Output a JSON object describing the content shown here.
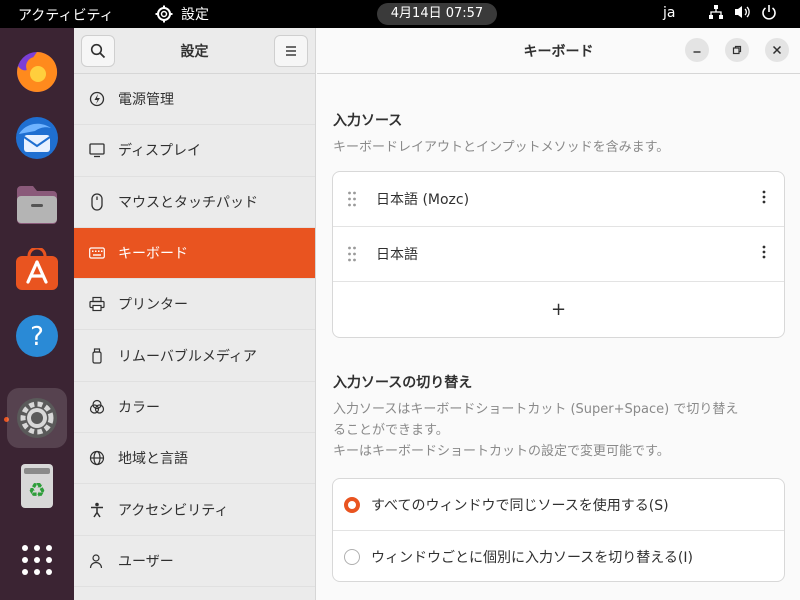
{
  "topbar": {
    "activities": "アクティビティ",
    "app_menu": "設定",
    "clock": "4月14日  07:57",
    "lang": "ja"
  },
  "dock": {
    "items": [
      "firefox-icon",
      "thunderbird-icon",
      "files-icon",
      "app-center-icon",
      "help-icon",
      "settings-icon",
      "trash-icon",
      "app-grid-icon"
    ]
  },
  "sidebar": {
    "title": "設定",
    "items": [
      {
        "label": "電源管理",
        "icon": "power-icon"
      },
      {
        "label": "ディスプレイ",
        "icon": "display-icon"
      },
      {
        "label": "マウスとタッチパッド",
        "icon": "mouse-icon"
      },
      {
        "label": "キーボード",
        "icon": "keyboard-icon",
        "selected": true
      },
      {
        "label": "プリンター",
        "icon": "printer-icon"
      },
      {
        "label": "リムーバブルメディア",
        "icon": "removable-media-icon"
      },
      {
        "label": "カラー",
        "icon": "color-icon"
      },
      {
        "label": "地域と言語",
        "icon": "globe-icon"
      },
      {
        "label": "アクセシビリティ",
        "icon": "accessibility-icon"
      },
      {
        "label": "ユーザー",
        "icon": "users-icon"
      }
    ]
  },
  "main": {
    "title": "キーボード",
    "input_sources": {
      "title": "入力ソース",
      "desc": "キーボードレイアウトとインプットメソッドを含みます。",
      "sources": [
        "日本語 (Mozc)",
        "日本語"
      ],
      "add_label": "+"
    },
    "switching": {
      "title": "入力ソースの切り替え",
      "desc_line1": "入力ソースはキーボードショートカット (Super+Space) で切り替え",
      "desc_line2": "ることができます。",
      "desc_line3": "キーはキーボードショートカットの設定で変更可能です。",
      "options": [
        {
          "label": "すべてのウィンドウで同じソースを使用する(S)",
          "selected": true
        },
        {
          "label": "ウィンドウごとに個別に入力ソースを切り替える(I)",
          "selected": false
        }
      ]
    }
  },
  "colors": {
    "accent": "#e95420",
    "dock_bg": "#3b2433",
    "topbar_bg": "#000000"
  }
}
